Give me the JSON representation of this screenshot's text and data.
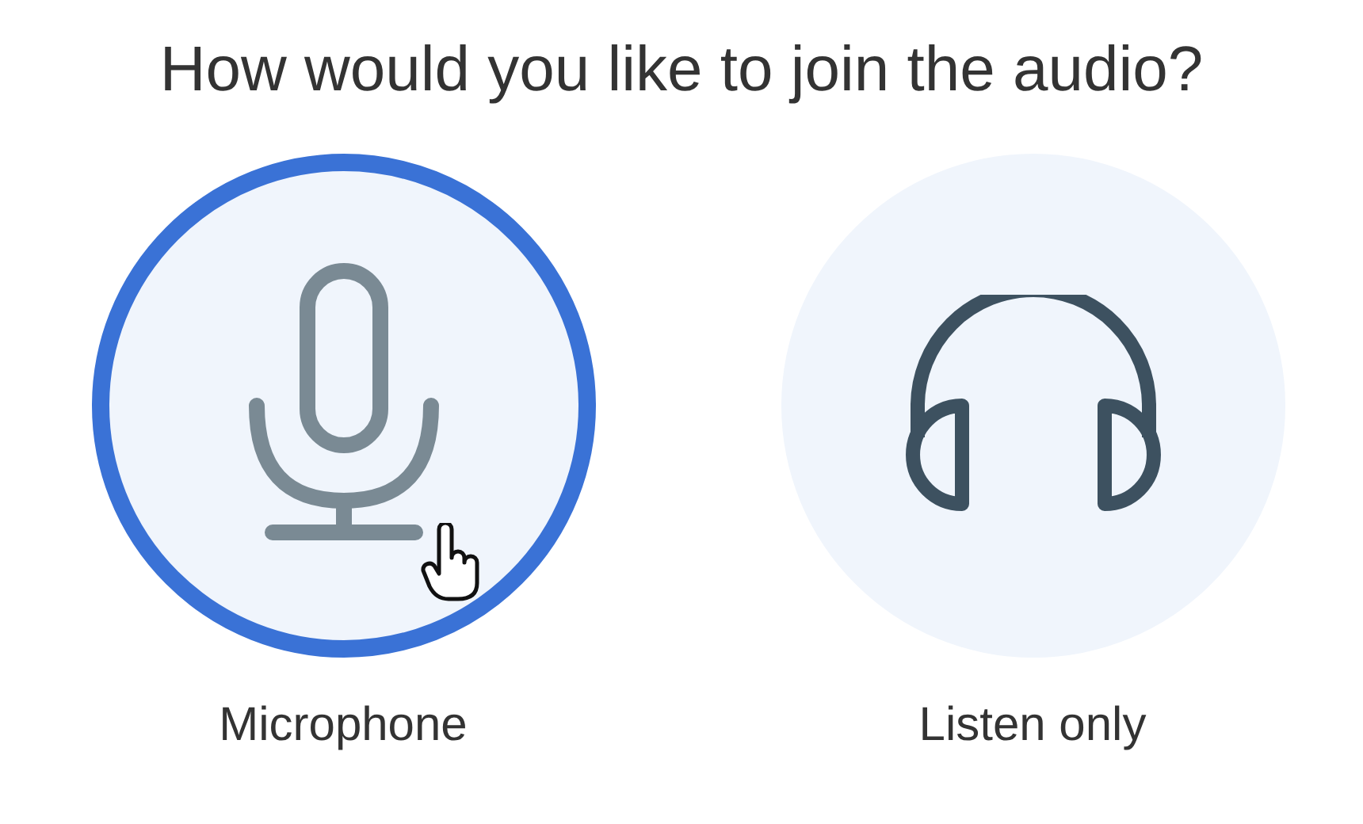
{
  "title": "How would you like to join the audio?",
  "options": [
    {
      "label": "Microphone",
      "kind": "microphone",
      "selected": true
    },
    {
      "label": "Listen only",
      "kind": "headphones",
      "selected": false
    }
  ]
}
